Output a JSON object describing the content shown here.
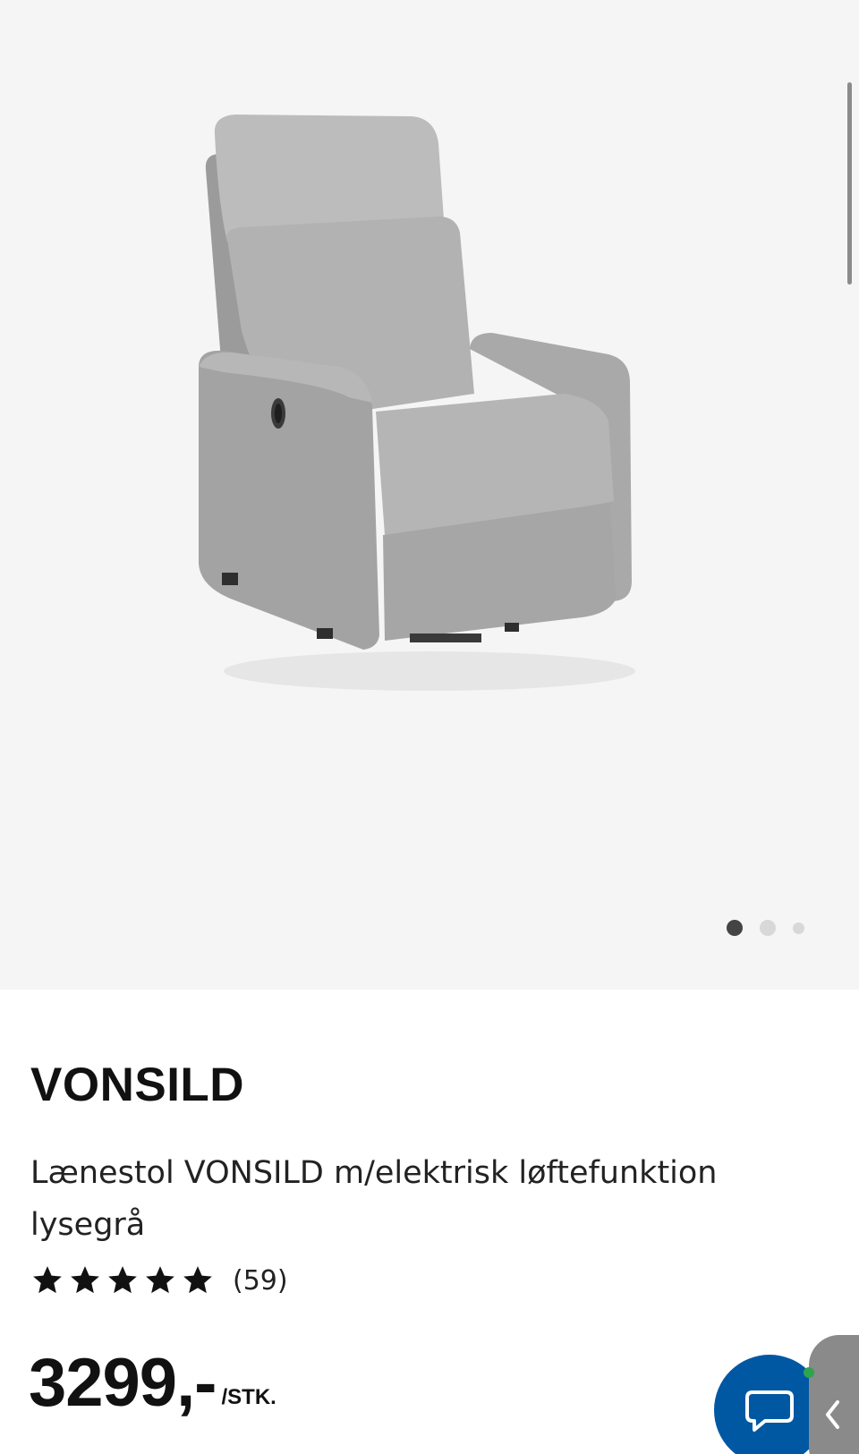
{
  "product": {
    "brand": "VONSILD",
    "description": "Lænestol VONSILD m/elektrisk løftefunktion lysegrå",
    "rating_stars": 5,
    "review_count": "(59)",
    "price": "3299,-",
    "price_unit": "/STK."
  },
  "gallery": {
    "image_count": 3,
    "active_index": 0
  },
  "icons": {
    "chat": "chat-bubble-icon",
    "side_tab": "chevron-left-icon",
    "star": "star-icon"
  },
  "colors": {
    "accent": "#0058a3",
    "gallery_bg": "#f5f5f5",
    "text": "#111111"
  }
}
